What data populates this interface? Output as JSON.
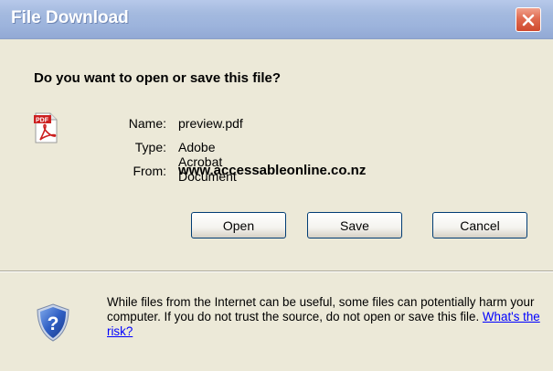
{
  "dialog": {
    "title": "File Download",
    "question": "Do you want to open or save this file?"
  },
  "file": {
    "icon": "pdf-file-icon",
    "name_label": "Name:",
    "name": "preview.pdf",
    "type_label": "Type:",
    "type": "Adobe Acrobat Document",
    "from_label": "From:",
    "from": "www.accessableonline.co.nz"
  },
  "buttons": {
    "open": "Open",
    "save": "Save",
    "cancel": "Cancel"
  },
  "warning": {
    "icon": "shield-question-icon",
    "text": "While files from the Internet can be useful, some files can potentially harm your computer. If you do not trust the source, do not open or save this file.",
    "link": "What's the risk?"
  },
  "colors": {
    "title_bar": "#a4badf",
    "close_button": "#e06b50",
    "client_background": "#ece9d8",
    "link": "#0000ff"
  }
}
